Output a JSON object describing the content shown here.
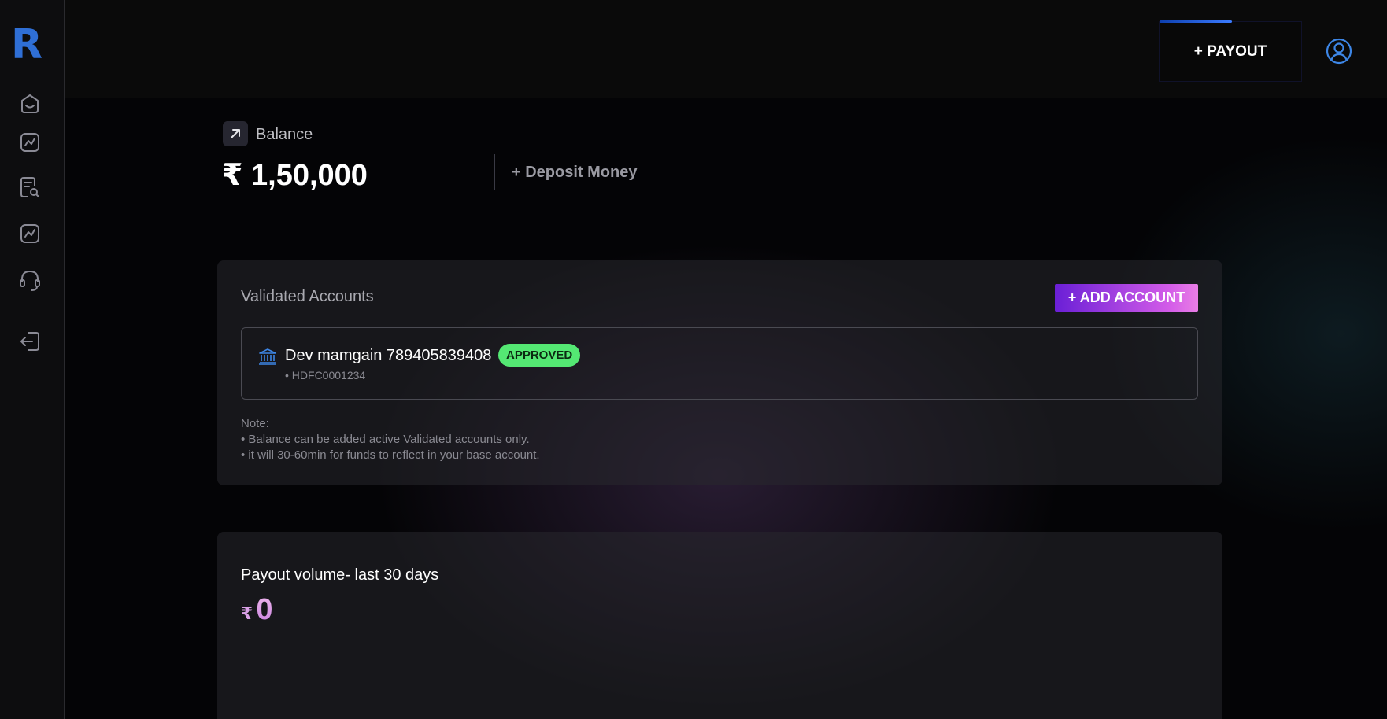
{
  "app": {
    "logo_letter": "R",
    "accent_color": "#2f6fd6"
  },
  "sidebar": {
    "items": [
      {
        "name": "home-icon"
      },
      {
        "name": "chart-icon"
      },
      {
        "name": "search-document-icon"
      },
      {
        "name": "analytics-icon"
      },
      {
        "name": "headset-icon"
      },
      {
        "name": "logout-icon"
      }
    ]
  },
  "header": {
    "payout_label": "+ PAYOUT",
    "user_icon": "user-circle-icon"
  },
  "balance": {
    "label": "Balance",
    "amount": "₹  1,50,000",
    "deposit_label": "+ Deposit Money",
    "badge_icon": "arrow-up-right-icon"
  },
  "accounts": {
    "title": "Validated Accounts",
    "add_label": "+ ADD ACCOUNT",
    "items": [
      {
        "name": "Dev mamgain 789405839408",
        "status": "APPROVED",
        "ifsc": "• HDFC0001234",
        "icon": "bank-icon"
      }
    ],
    "note_title": "Note:",
    "note_lines": [
      "• Balance can be added active Validated accounts only.",
      "• it will 30-60min for funds to reflect in your base account."
    ]
  },
  "payout_volume": {
    "title": "Payout volume- last 30 days",
    "currency": "₹",
    "value": "0"
  }
}
